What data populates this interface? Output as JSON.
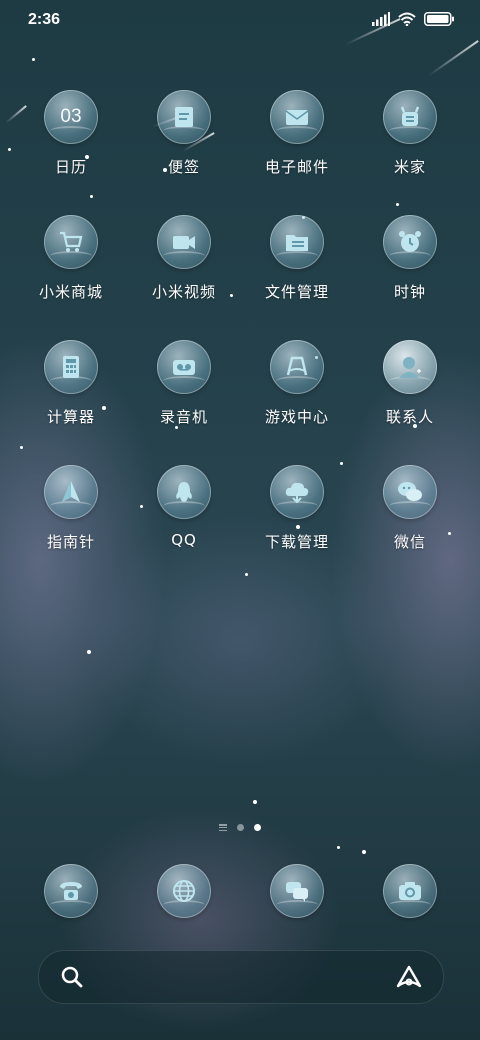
{
  "status_bar": {
    "time": "2:36",
    "icons": [
      "signal-icon",
      "wifi-icon",
      "battery-icon"
    ]
  },
  "apps": [
    {
      "label": "日历",
      "icon": "calendar-icon",
      "icon_text": "03"
    },
    {
      "label": "便签",
      "icon": "notes-icon"
    },
    {
      "label": "电子邮件",
      "icon": "mail-icon"
    },
    {
      "label": "米家",
      "icon": "mijia-icon"
    },
    {
      "label": "小米商城",
      "icon": "shopping-cart-icon"
    },
    {
      "label": "小米视频",
      "icon": "video-camera-icon"
    },
    {
      "label": "文件管理",
      "icon": "folder-icon"
    },
    {
      "label": "时钟",
      "icon": "alarm-clock-icon"
    },
    {
      "label": "计算器",
      "icon": "calculator-icon"
    },
    {
      "label": "录音机",
      "icon": "recorder-icon"
    },
    {
      "label": "游戏中心",
      "icon": "game-center-icon"
    },
    {
      "label": "联系人",
      "icon": "contacts-icon"
    },
    {
      "label": "指南针",
      "icon": "compass-icon"
    },
    {
      "label": "QQ",
      "icon": "qq-icon"
    },
    {
      "label": "下载管理",
      "icon": "download-cloud-icon"
    },
    {
      "label": "微信",
      "icon": "wechat-icon"
    }
  ],
  "page_indicator": {
    "pages": 2,
    "active": 2
  },
  "dock": [
    {
      "icon": "phone-icon"
    },
    {
      "icon": "browser-globe-icon"
    },
    {
      "icon": "messages-icon"
    },
    {
      "icon": "camera-icon"
    }
  ],
  "search": {
    "icons": [
      "search-icon",
      "assistant-icon"
    ]
  },
  "colors": {
    "background": "#24414b",
    "icon_glass": "#8fbccb",
    "text": "#ffffff"
  }
}
